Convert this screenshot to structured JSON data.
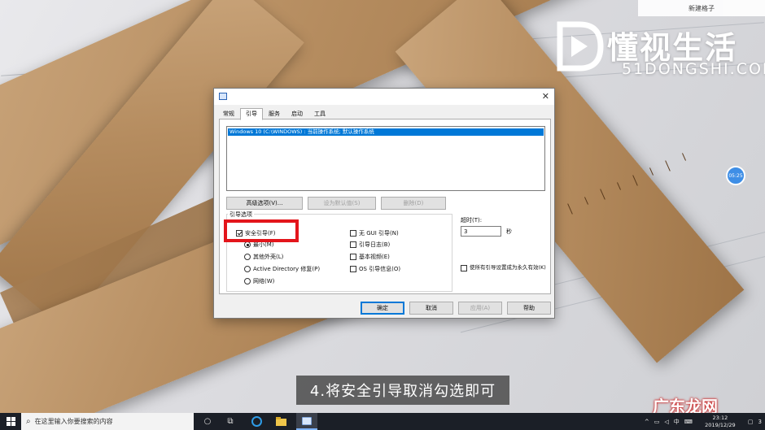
{
  "overlay": {
    "top_badge": "新建格子",
    "logo_main": "懂视生活",
    "logo_sub": "51DONGSHI.COM",
    "bubble": "05:25",
    "caption": "4.将安全引导取消勾选即可",
    "watermark": "广东龙网"
  },
  "dialog": {
    "tabs": [
      {
        "label": "常规",
        "active": false
      },
      {
        "label": "引导",
        "active": true
      },
      {
        "label": "服务",
        "active": false
      },
      {
        "label": "启动",
        "active": false
      },
      {
        "label": "工具",
        "active": false
      }
    ],
    "os_entry": "Windows 10 (C:\\WINDOWS) : 当前操作系统; 默认操作系统",
    "buttons": {
      "advanced": "高级选项(V)...",
      "set_default": "设为默认值(S)",
      "delete": "删除(D)"
    },
    "boot_options": {
      "legend": "引导选项",
      "safe_boot": "安全引导(F)",
      "minimal": "最小(M)",
      "alternate_shell": "其他外壳(L)",
      "ad_repair": "Active Directory 修复(P)",
      "network": "网络(W)",
      "no_gui": "无 GUI 引导(N)",
      "boot_log": "引导日志(B)",
      "base_video": "基本视频(E)",
      "os_info": "OS 引导信息(O)"
    },
    "timeout": {
      "label": "超时(T):",
      "value": "3",
      "unit": "秒"
    },
    "permanent": "使所有引导设置成为永久有效(K)",
    "footer": {
      "ok": "确定",
      "cancel": "取消",
      "apply": "应用(A)",
      "help": "帮助"
    }
  },
  "taskbar": {
    "search_placeholder": "在这里输入你要搜索的内容",
    "time": "23:12",
    "date": "2019/12/29",
    "ime": "中",
    "notification_count": "3"
  }
}
